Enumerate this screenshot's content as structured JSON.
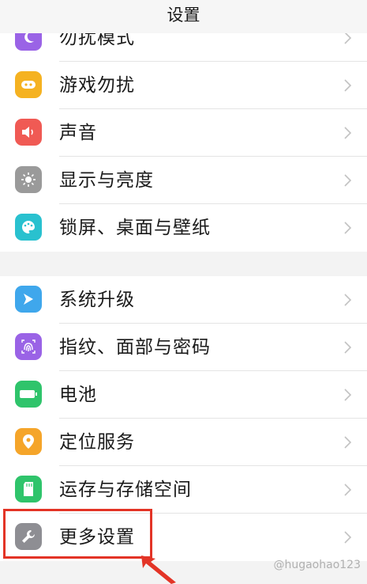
{
  "header": {
    "title": "设置"
  },
  "groups": [
    {
      "items": [
        {
          "label": "勿扰模式",
          "icon": "moon-icon",
          "color": "#9a63e6"
        },
        {
          "label": "游戏勿扰",
          "icon": "gamepad-icon",
          "color": "#f5b221"
        },
        {
          "label": "声音",
          "icon": "speaker-icon",
          "color": "#f05a54"
        },
        {
          "label": "显示与亮度",
          "icon": "sun-icon",
          "color": "#9a9a9a"
        },
        {
          "label": "锁屏、桌面与壁纸",
          "icon": "palette-icon",
          "color": "#29c1cf"
        }
      ]
    },
    {
      "items": [
        {
          "label": "系统升级",
          "icon": "update-icon",
          "color": "#3fa7ec"
        },
        {
          "label": "指纹、面部与密码",
          "icon": "fingerprint-icon",
          "color": "#9a63e6"
        },
        {
          "label": "电池",
          "icon": "battery-icon",
          "color": "#2fc46b"
        },
        {
          "label": "定位服务",
          "icon": "location-pin-icon",
          "color": "#f5a52a"
        },
        {
          "label": "运存与存储空间",
          "icon": "sd-card-icon",
          "color": "#2fc46b"
        },
        {
          "label": "更多设置",
          "icon": "wrench-icon",
          "color": "#8e8e93"
        }
      ]
    }
  ],
  "watermark": "@hugaohao123"
}
